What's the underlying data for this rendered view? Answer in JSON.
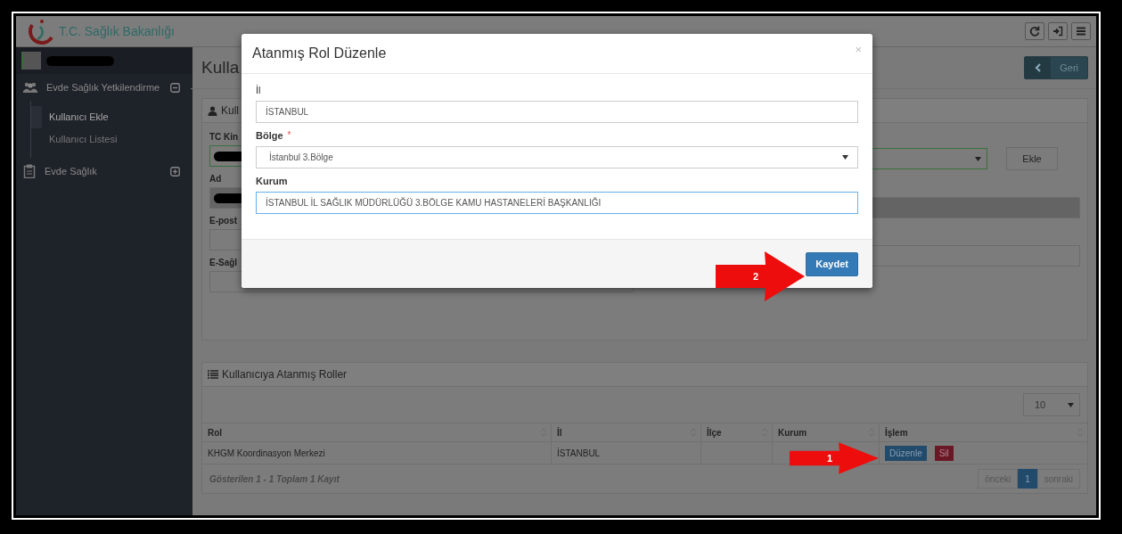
{
  "header": {
    "logo_text": "T.C. Sağlık Bakanlığı"
  },
  "sidebar": {
    "items": [
      {
        "label": "Evde Sağlık Yetkilendirme",
        "expanded": true,
        "children": [
          {
            "label": "Kullanıcı Ekle",
            "selected": true
          },
          {
            "label": "Kullanıcı Listesi",
            "selected": false
          }
        ]
      },
      {
        "label": "Evde Sağlık",
        "expanded": false
      }
    ]
  },
  "page": {
    "title": "Kulla",
    "back_button": "Geri"
  },
  "user_panel": {
    "title": "Kull",
    "fields": [
      {
        "label": "TC Kin",
        "redacted": true,
        "valid": true,
        "disabled": false
      },
      {
        "label": "Ad",
        "redacted": true,
        "valid": false,
        "disabled": true
      },
      {
        "label": "E-post",
        "redacted": false,
        "valid": false,
        "disabled": false
      },
      {
        "label": "E-Sağl",
        "redacted": false,
        "valid": false,
        "disabled": false
      }
    ],
    "right_fields": [
      {
        "kind": "select",
        "valid": true,
        "disabled": false
      },
      {
        "kind": "input",
        "valid": false,
        "disabled": true
      },
      {
        "kind": "input",
        "valid": false,
        "disabled": false
      }
    ],
    "add_button": "Ekle"
  },
  "roles_panel": {
    "title": "Kullanıcıya Atanmış Roller",
    "page_size": "10",
    "table": {
      "columns": [
        "Rol",
        "İl",
        "İlçe",
        "Kurum",
        "İşlem"
      ],
      "rows": [
        {
          "rol": "KHGM Koordinasyon Merkezi",
          "il": "İSTANBUL",
          "actions": [
            {
              "label": "Düzenle",
              "kind": "primary"
            },
            {
              "label": "Sil",
              "kind": "danger"
            }
          ]
        }
      ]
    },
    "summary": "Gösterilen 1 - 1 Toplam 1 Kayıt",
    "pagination": {
      "previous": "önceki",
      "pages": [
        {
          "label": "1",
          "selected": true
        }
      ],
      "next": "sonraki"
    }
  },
  "modal": {
    "title": "Atanmış Rol Düzenle",
    "close": "×",
    "fields": [
      {
        "label": "İl",
        "kind": "input",
        "value": "İSTANBUL",
        "focused": false
      },
      {
        "label": "Bölge",
        "required_mark": "*",
        "kind": "select",
        "value": "İstanbul 3.Bölge",
        "focused": false
      },
      {
        "label": "Kurum",
        "kind": "input",
        "value": "İSTANBUL İL SAĞLIK MÜDÜRLÜĞÜ 3.BÖLGE KAMU HASTANELERİ BAŞKANLIĞI",
        "focused": true
      }
    ],
    "save_button": "Kaydet"
  },
  "annotations": [
    {
      "number": "1"
    },
    {
      "number": "2"
    }
  ]
}
